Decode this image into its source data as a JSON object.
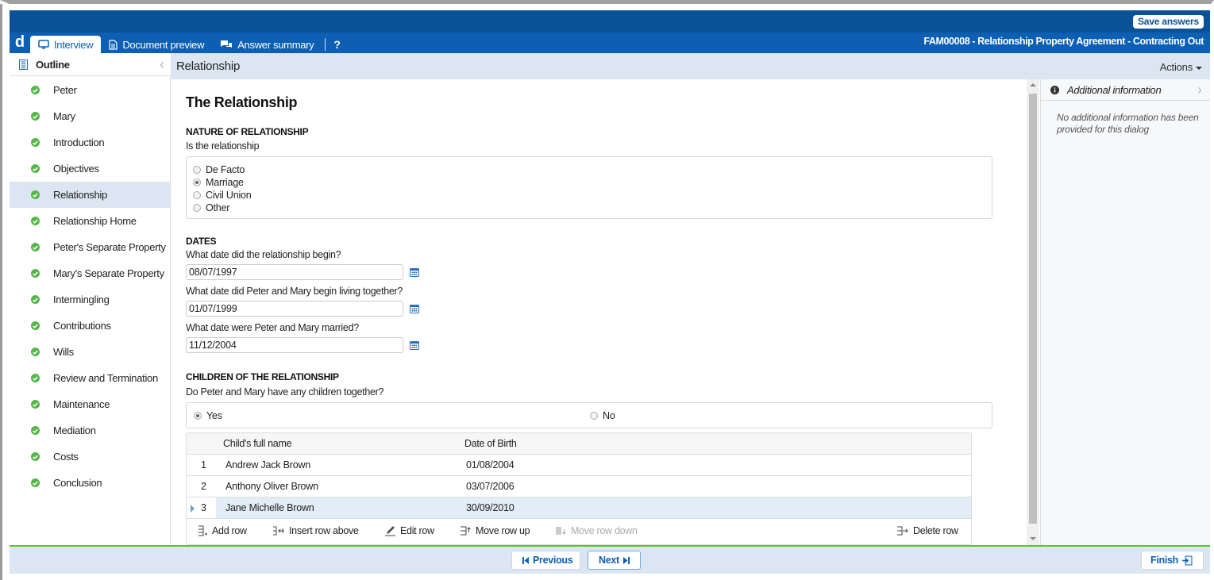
{
  "app": {
    "logo": "d",
    "save_label": "Save answers",
    "document_title": "FAM00008 - Relationship Property Agreement - Contracting Out",
    "help_label": "?"
  },
  "tabs": [
    {
      "label": "Interview",
      "icon": "monitor-icon",
      "active": true
    },
    {
      "label": "Document preview",
      "icon": "document-icon",
      "active": false
    },
    {
      "label": "Answer summary",
      "icon": "chat-icon",
      "active": false
    }
  ],
  "outline": {
    "title": "Outline",
    "collapse_icon": "chevron-left-icon",
    "items": [
      {
        "label": "Peter",
        "status": "complete"
      },
      {
        "label": "Mary",
        "status": "complete"
      },
      {
        "label": "Introduction",
        "status": "complete"
      },
      {
        "label": "Objectives",
        "status": "complete"
      },
      {
        "label": "Relationship",
        "status": "complete",
        "active": true
      },
      {
        "label": "Relationship Home",
        "status": "complete"
      },
      {
        "label": "Peter's Separate Property",
        "status": "complete"
      },
      {
        "label": "Mary's Separate Property",
        "status": "complete"
      },
      {
        "label": "Intermingling",
        "status": "complete"
      },
      {
        "label": "Contributions",
        "status": "complete"
      },
      {
        "label": "Wills",
        "status": "complete"
      },
      {
        "label": "Review and Termination",
        "status": "complete"
      },
      {
        "label": "Maintenance",
        "status": "complete"
      },
      {
        "label": "Mediation",
        "status": "complete"
      },
      {
        "label": "Costs",
        "status": "complete"
      },
      {
        "label": "Conclusion",
        "status": "complete"
      }
    ]
  },
  "page": {
    "header_title": "Relationship",
    "actions_label": "Actions",
    "section_title": "The Relationship",
    "nature": {
      "heading": "NATURE OF RELATIONSHIP",
      "question": "Is the relationship",
      "options": [
        {
          "label": "De Facto",
          "selected": false
        },
        {
          "label": "Marriage",
          "selected": true
        },
        {
          "label": "Civil Union",
          "selected": false
        },
        {
          "label": "Other",
          "selected": false
        }
      ]
    },
    "dates": {
      "heading": "DATES",
      "fields": [
        {
          "label": "What date did the relationship begin?",
          "value": "08/07/1997"
        },
        {
          "label": "What date did Peter and Mary begin living together?",
          "value": "01/07/1999"
        },
        {
          "label": "What date were Peter and Mary married?",
          "value": "11/12/2004"
        }
      ]
    },
    "children": {
      "heading": "CHILDREN OF THE RELATIONSHIP",
      "question": "Do Peter and Mary have any children together?",
      "options": [
        {
          "label": "Yes",
          "selected": true
        },
        {
          "label": "No",
          "selected": false
        }
      ],
      "table": {
        "columns": [
          "Child's full name",
          "Date of Birth"
        ],
        "rows": [
          {
            "num": "1",
            "name": "Andrew Jack Brown",
            "dob": "01/08/2004",
            "selected": false
          },
          {
            "num": "2",
            "name": "Anthony Oliver Brown",
            "dob": "03/07/2006",
            "selected": false
          },
          {
            "num": "3",
            "name": "Jane Michelle Brown",
            "dob": "30/09/2010",
            "selected": true
          }
        ],
        "toolbar": {
          "add_row": "Add row",
          "insert_row_above": "Insert row above",
          "edit_row": "Edit row",
          "move_row_up": "Move row up",
          "move_row_down": "Move row down",
          "delete_row": "Delete row"
        }
      }
    }
  },
  "info_panel": {
    "title": "Additional information",
    "body": "No additional information has been provided for this dialog"
  },
  "footer": {
    "previous_label": "Previous",
    "next_label": "Next",
    "finish_label": "Finish"
  },
  "colors": {
    "topbar": "#0a5297",
    "tabbar": "#0c5fb3",
    "header_bg": "#dbe6f2",
    "complete_check": "#56b64a",
    "footer_accent": "#5fc225"
  }
}
